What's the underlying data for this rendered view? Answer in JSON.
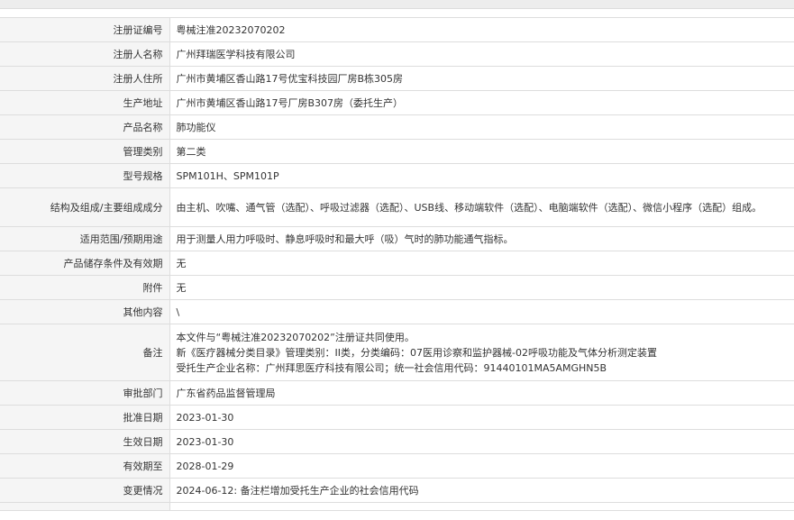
{
  "rows": [
    {
      "label": "注册证编号",
      "value": "粤械注准20232070202"
    },
    {
      "label": "注册人名称",
      "value": "广州拜瑞医学科技有限公司"
    },
    {
      "label": "注册人住所",
      "value": "广州市黄埔区香山路17号优宝科技园厂房B栋305房"
    },
    {
      "label": "生产地址",
      "value": "广州市黄埔区香山路17号厂房B307房（委托生产）"
    },
    {
      "label": "产品名称",
      "value": "肺功能仪"
    },
    {
      "label": "管理类别",
      "value": "第二类"
    },
    {
      "label": "型号规格",
      "value": "SPM101H、SPM101P"
    },
    {
      "label": "结构及组成/主要组成成分",
      "value": "由主机、吹嘴、通气管（选配）、呼吸过滤器（选配）、USB线、移动端软件（选配）、电脑端软件（选配）、微信小程序（选配）组成。"
    },
    {
      "label": "适用范围/预期用途",
      "value": "用于测量人用力呼吸时、静息呼吸时和最大呼（吸）气时的肺功能通气指标。"
    },
    {
      "label": "产品储存条件及有效期",
      "value": "无"
    },
    {
      "label": "附件",
      "value": "无"
    },
    {
      "label": "其他内容",
      "value": "\\"
    },
    {
      "label": "备注",
      "lines": [
        "本文件与“粤械注准20232070202”注册证共同使用。",
        "新《医疗器械分类目录》管理类别：II类，分类编码：07医用诊察和监护器械-02呼吸功能及气体分析测定装置",
        "受托生产企业名称：广州拜思医疗科技有限公司；统一社会信用代码：91440101MA5AMGHN5B"
      ]
    },
    {
      "label": "审批部门",
      "value": "广东省药品监督管理局"
    },
    {
      "label": "批准日期",
      "value": "2023-01-30"
    },
    {
      "label": "生效日期",
      "value": "2023-01-30"
    },
    {
      "label": "有效期至",
      "value": "2028-01-29"
    },
    {
      "label": "变更情况",
      "value": "2024-06-12: 备注栏增加受托生产企业的社会信用代码"
    }
  ]
}
